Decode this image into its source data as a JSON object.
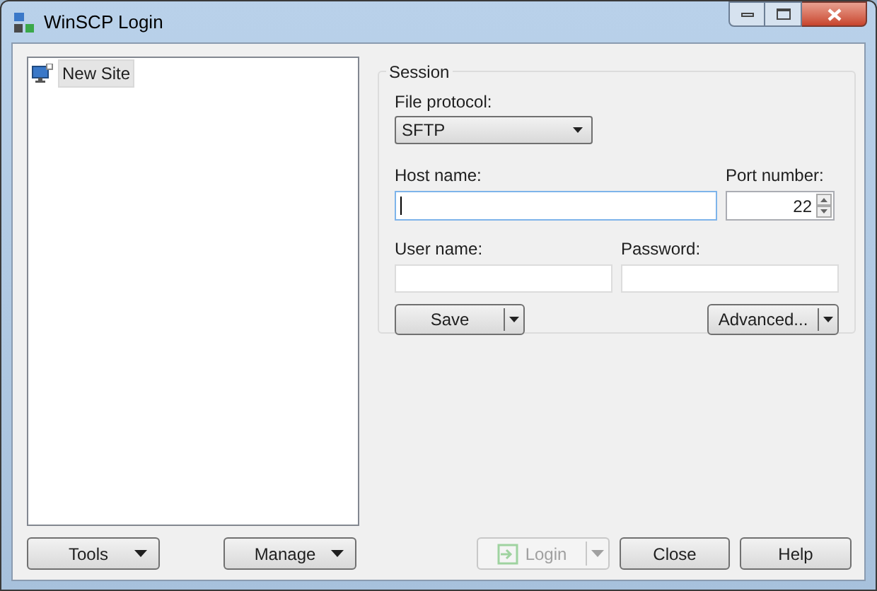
{
  "window": {
    "title": "WinSCP Login"
  },
  "sites": [
    {
      "label": "New Site",
      "selected": true
    }
  ],
  "session": {
    "title": "Session",
    "file_protocol": {
      "label": "File protocol:",
      "value": "SFTP"
    },
    "host_name": {
      "label": "Host name:"
    },
    "port_number": {
      "label": "Port number:",
      "value": "22"
    },
    "user_name": {
      "label": "User name:"
    },
    "password": {
      "label": "Password:"
    },
    "save_button": "Save",
    "advanced_button": "Advanced..."
  },
  "buttons": [
    {
      "label": "Tools",
      "kind": "menu",
      "disabled": false
    },
    {
      "label": "Manage",
      "kind": "menu",
      "disabled": false
    },
    {
      "label": "Login",
      "kind": "split",
      "disabled": true
    },
    {
      "label": "Close",
      "kind": "plain",
      "disabled": false
    },
    {
      "label": "Help",
      "kind": "plain",
      "disabled": false
    }
  ]
}
